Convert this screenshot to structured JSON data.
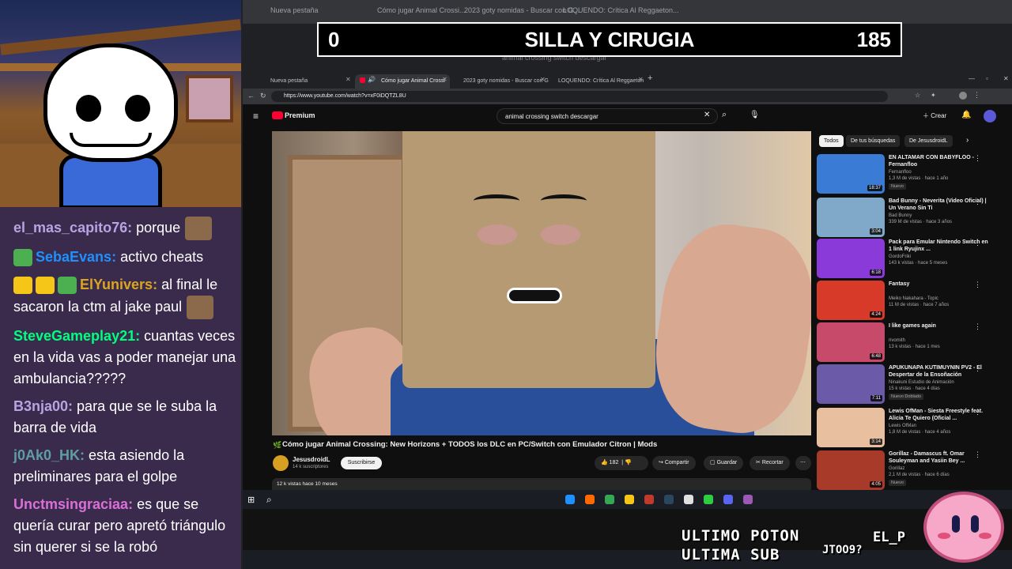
{
  "overlay": {
    "left_count": "0",
    "title": "SILLA Y CIRUGIA",
    "right_count": "185",
    "bottom_line1": "ULTIMO POTON",
    "bottom_line2": "ULTIMA SUB",
    "bottom_name_a": "EL_P",
    "bottom_name_b": "JTOO9?"
  },
  "chat": [
    {
      "user": "el_mas_capito76",
      "color": "#b9a3e3",
      "text": " porque",
      "badges": [],
      "emote": true
    },
    {
      "user": "SebaEvans",
      "color": "#1e90ff",
      "text": " activo cheats",
      "badges": [
        "#4caf50"
      ],
      "emote": false
    },
    {
      "user": "ElYunivers",
      "color": "#daa520",
      "text": " al final le sacaron la ctm al jake paul",
      "badges": [
        "#f5c518",
        "#f5c518",
        "#4caf50"
      ],
      "emote": true
    },
    {
      "user": "SteveGameplay21",
      "color": "#00ff7f",
      "text": " cuantas veces en la vida vas a poder manejar una ambulancia?????",
      "badges": [],
      "emote": false
    },
    {
      "user": "B3nja00",
      "color": "#b9a3e3",
      "text": " para que se le suba la barra de vida",
      "badges": [],
      "emote": false
    },
    {
      "user": "j0Ak0_HK",
      "color": "#5f9ea0",
      "text": " esta asiendo la preliminares para el golpe",
      "badges": [],
      "emote": false
    },
    {
      "user": "Unctmsingraciaa",
      "color": "#da70d6",
      "text": " es que se quería curar pero apretó triángulo sin querer si se la robó",
      "badges": [],
      "emote": false
    }
  ],
  "bg_browser": {
    "tabs": [
      "Nueva pestaña",
      "Cómo jugar Animal Crossi...",
      "2023 goty nomidas - Buscar con G...",
      "LOQUENDO: Crítica Al Reggaeton..."
    ],
    "search": "animal crossing switch descargar"
  },
  "browser": {
    "tabs": [
      "Nueva pestaña",
      "Cómo jugar Animal Crossi",
      "2023 goty nomidas - Buscar con G",
      "LOQUENDO: Crítica Al Reggaeton"
    ],
    "new_tab": "+",
    "url": "https://www.youtube.com/watch?v=xF0iDQTZL8U"
  },
  "youtube": {
    "logo": "Premium",
    "search_value": "animal crossing switch descargar",
    "create_label": "Crear",
    "video_title": "Cómo jugar Animal Crossing: New Horizons + TODOS los DLC en PC/Switch con Emulador Citron | Mods",
    "channel": "JesusdroidL",
    "subscribers": "14 k suscriptores",
    "subscribe": "Suscribirse",
    "likes": "182",
    "share": "Compartir",
    "save": "Guardar",
    "clip": "Recortar",
    "views_date": "12 k vistas  hace 10 meses",
    "chips": [
      "Todos",
      "De tus búsquedas",
      "De JesusdroidL"
    ],
    "recommended": [
      {
        "title": "EN ALTAMAR CON BABYFLOO - Fernanfloo",
        "channel": "Fernanfloo",
        "meta": "1,3 M de vistas · hace 1 año",
        "duration": "18:37",
        "badge": "Nuevo",
        "color": "#3a7bd5"
      },
      {
        "title": "Bad Bunny - Neverita (Video Oficial) | Un Verano Sin Ti",
        "channel": "Bad Bunny",
        "meta": "339 M de vistas · hace 3 años",
        "duration": "3:04",
        "badge": "",
        "color": "#7fa8c9"
      },
      {
        "title": "Pack para Emular Nintendo Switch en 1 link Ryujinx ...",
        "channel": "GordoFriki",
        "meta": "143 k vistas · hace 5 meses",
        "duration": "6:18",
        "badge": "",
        "color": "#8a3ad8"
      },
      {
        "title": "Fantasy",
        "channel": "Meiko Nakahara - Topic",
        "meta": "11 M de vistas · hace 7 años",
        "duration": "4:24",
        "badge": "",
        "color": "#d83a2a"
      },
      {
        "title": "I like games again",
        "channel": "rivomith",
        "meta": "13 k vistas · hace 1 mes",
        "duration": "6:48",
        "badge": "",
        "color": "#c84a6a"
      },
      {
        "title": "APUKUNAPA KUTIMUYNIN PV2 - El Despertar de la Ensoñación",
        "channel": "Ninakuni Estudio de Animación",
        "meta": "15 k vistas · hace 4 días",
        "duration": "7:11",
        "badge": "Nuevo  Doblado",
        "color": "#6a5aa8"
      },
      {
        "title": "Lewis OfMan - Siesta Freestyle feat. Alicia Te Quiero (Oficial ...",
        "channel": "Lewis OfMan",
        "meta": "1,8 M de vistas · hace 4 años",
        "duration": "3:14",
        "badge": "",
        "color": "#e8c0a0"
      },
      {
        "title": "Gorillaz - Damascus ft. Omar Souleyman and Yasiin Bey ...",
        "channel": "Gorillaz",
        "meta": "2,1 M de vistas · hace 6 días",
        "duration": "4:05",
        "badge": "Nuevo",
        "color": "#a83a2a"
      }
    ]
  },
  "colors": {
    "accent_red": "#ff0033",
    "chat_bg": "#3a2b4d",
    "yt_bg": "#0f0f0f"
  }
}
